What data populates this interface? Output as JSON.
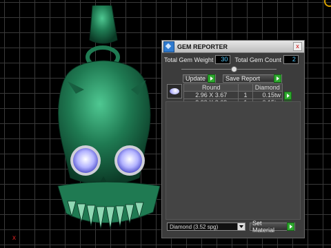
{
  "viewport": {
    "axis_label": "x"
  },
  "panel": {
    "title": "GEM REPORTER",
    "close_glyph": "x",
    "total_weight_label": "Total Gem Weight",
    "total_weight_value": "30",
    "total_count_label": "Total Gem Count",
    "total_count_value": "2",
    "update_label": "Update",
    "save_report_label": "Save Report",
    "table": {
      "headers": [
        "",
        "Round",
        "",
        "Diamond"
      ],
      "rows": [
        {
          "size": "2.96 X 3.67",
          "qty": "1",
          "weight": "0.15tw"
        },
        {
          "size": "2.99 X 3.69",
          "qty": "1",
          "weight": "0.15tw"
        }
      ]
    },
    "material_select_value": "Diamond   (3.52 spg)",
    "set_material_label": "Set Material"
  },
  "colors": {
    "skull": "#1f7a52",
    "accent_green": "#2fa82f",
    "value_text": "#55ccff"
  }
}
